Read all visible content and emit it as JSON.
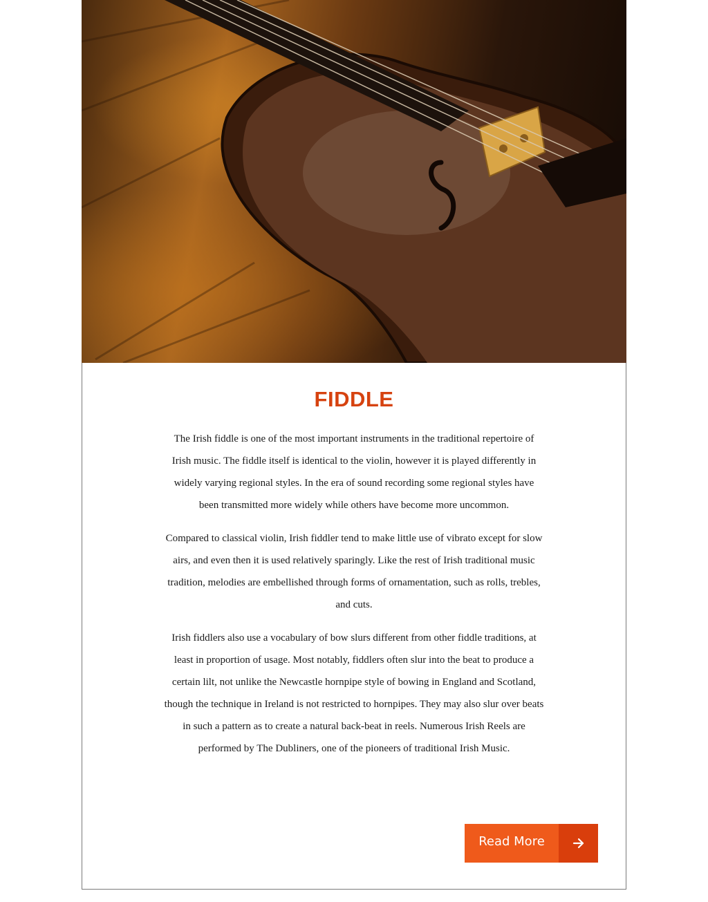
{
  "article": {
    "title": "FIDDLE",
    "paragraphs": [
      "The Irish fiddle is one of the most important instruments in the traditional repertoire of Irish music. The fiddle itself is identical to the violin, however it is played differently in widely varying regional styles. In the era of sound recording some regional styles have been transmitted more widely while others have become more uncommon.",
      "Compared to classical violin, Irish fiddler tend to make little use of vibrato except for slow airs, and even then it is used relatively sparingly. Like the rest of Irish traditional music tradition, melodies are embellished through forms of ornamentation, such as rolls, trebles, and cuts.",
      "Irish fiddlers also use a vocabulary of bow slurs different from other fiddle traditions, at least in proportion of usage. Most notably, fiddlers often slur into the beat to produce a certain lilt, not unlike the Newcastle hornpipe style of bowing in England and Scotland, though the technique in Ireland is not restricted to hornpipes. They may also slur over beats in such a pattern as to create a natural back-beat in reels. Numerous Irish Reels are performed by The Dubliners, one of the pioneers of traditional Irish Music."
    ],
    "read_more": {
      "label": "Read More",
      "icon": "arrow-right-icon"
    }
  },
  "colors": {
    "accent": "#d6420f",
    "button": "#ef5a1b",
    "button_dark": "#d93e0c"
  }
}
